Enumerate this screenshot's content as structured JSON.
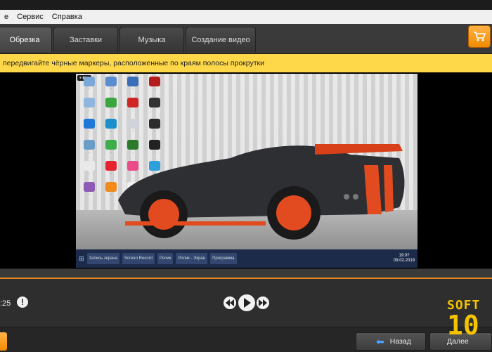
{
  "menu": [
    "е",
    "Сервис",
    "Справка"
  ],
  "tabs": [
    {
      "label": "Обрезка",
      "active": true
    },
    {
      "label": "Заставки",
      "active": false
    },
    {
      "label": "Музыка",
      "active": false
    },
    {
      "label": "Создание видео",
      "active": false
    }
  ],
  "hint": "передвигайте чёрные маркеры, расположенные по краям полосы прокрутки",
  "preview": {
    "taskbar_items": [
      "Запись экрана",
      "Screen Record",
      "Ролик",
      "Ролик - Экран",
      "Программа"
    ],
    "clock_time": "19:0?",
    "clock_date": "09.02.2019"
  },
  "player": {
    "time": ":25",
    "info_label": "!"
  },
  "nav": {
    "back_label": "Назад",
    "next_label": "Далее"
  },
  "watermark": {
    "line1": "SOFT",
    "line2": "10"
  },
  "colors": {
    "accent": "#f08a00",
    "hint_bg": "#ffd84a",
    "progress": "#e8871e"
  }
}
